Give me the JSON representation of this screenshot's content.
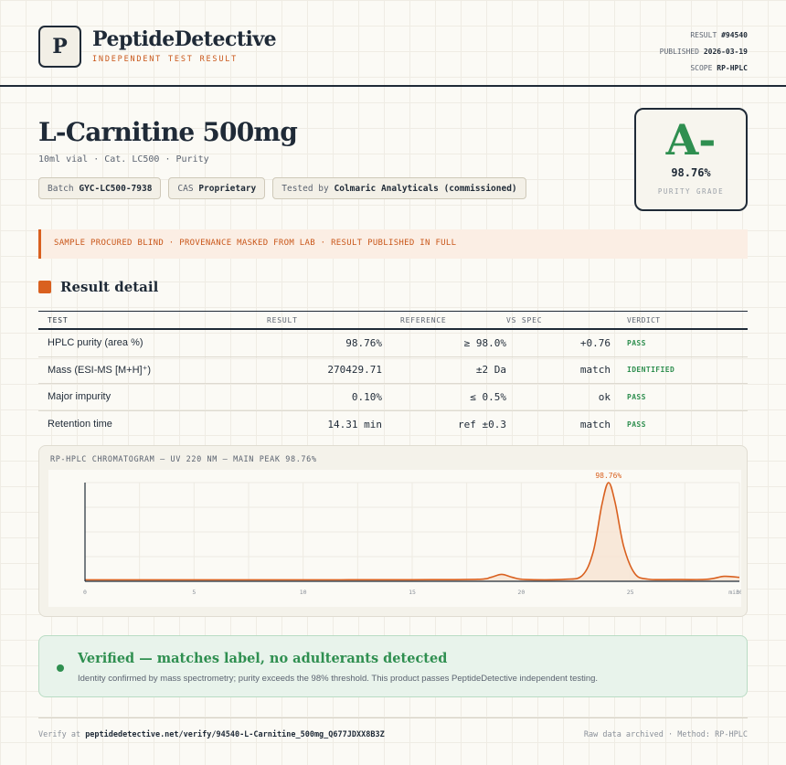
{
  "header": {
    "logo_letter": "P",
    "brand": "PeptideDetective",
    "brand_sub": "INDEPENDENT TEST RESULT",
    "meta": [
      {
        "label": "RESULT",
        "value": "#94540"
      },
      {
        "label": "PUBLISHED",
        "value": "2026-03-19"
      },
      {
        "label": "SCOPE",
        "value": "RP-HPLC"
      }
    ]
  },
  "product": {
    "title": "L-Carnitine 500mg",
    "subtitle": "10ml vial · Cat. LC500 · Purity",
    "chips": [
      {
        "label": "Batch",
        "value": "GYC-LC500-7938"
      },
      {
        "label": "CAS",
        "value": "Proprietary"
      },
      {
        "label": "Tested by",
        "value": "Colmaric Analyticals (commissioned)"
      }
    ]
  },
  "grade": {
    "letter": "A-",
    "percent": "98.76%",
    "label": "PURITY GRADE"
  },
  "notice": "SAMPLE PROCURED BLIND · PROVENANCE MASKED FROM LAB · RESULT PUBLISHED IN FULL",
  "section_title": "Result detail",
  "table": {
    "headers": [
      "TEST",
      "RESULT",
      "REFERENCE",
      "VS SPEC",
      "VERDICT"
    ],
    "rows": [
      {
        "test": "HPLC purity (area %)",
        "result": "98.76%",
        "reference": "≥ 98.0%",
        "vs_spec": "+0.76",
        "verdict": "PASS"
      },
      {
        "test": "Mass (ESI-MS [M+H]⁺)",
        "result": "270429.71",
        "reference": "±2 Da",
        "vs_spec": "match",
        "verdict": "IDENTIFIED"
      },
      {
        "test": "Major impurity",
        "result": "0.10%",
        "reference": "≤ 0.5%",
        "vs_spec": "ok",
        "verdict": "PASS"
      },
      {
        "test": "Retention time",
        "result": "14.31 min",
        "reference": "ref ±0.3",
        "vs_spec": "match",
        "verdict": "PASS"
      }
    ]
  },
  "chart_title": "RP-HPLC CHROMATOGRAM — UV 220 NM — MAIN PEAK 98.76%",
  "chart_data": {
    "type": "line",
    "title": "RP-HPLC CHROMATOGRAM — UV 220 NM — MAIN PEAK 98.76%",
    "xlabel": "",
    "ylabel": "",
    "xlim": [
      0,
      30
    ],
    "ylim": [
      0,
      100
    ],
    "x_ticks": [
      "0",
      "5",
      "10",
      "15",
      "20",
      "25",
      "30"
    ],
    "x_tick_suffix": "min",
    "peak_annotation": "98.76%",
    "x": [
      0,
      5,
      10,
      15,
      18,
      18.6,
      19.1,
      19.6,
      20.2,
      22,
      22.8,
      23.3,
      23.7,
      24.0,
      24.3,
      24.7,
      25.2,
      25.8,
      27,
      28.5,
      29.3,
      30
    ],
    "y": [
      1.5,
      1.5,
      1.5,
      1.6,
      2,
      4,
      7,
      4,
      1.8,
      2,
      6,
      30,
      78,
      100,
      80,
      35,
      8,
      2.2,
      1.8,
      2,
      5,
      4
    ],
    "line_color": "#d9601f",
    "fill_color": "#f8e3d2"
  },
  "verified": {
    "title": "Verified — matches label, no adulterants detected",
    "body": "Identity confirmed by mass spectrometry; purity exceeds the 98% threshold. This product passes PeptideDetective independent testing."
  },
  "footer": {
    "verify_prefix": "Verify at",
    "verify_url": "peptidedetective.net/verify/94540-L-Carnitine_500mg_Q677JDXX8B3Z",
    "right": "Raw data archived · Method: RP-HPLC"
  },
  "colors": {
    "accent": "#d9601f",
    "pass": "#2f8f50",
    "ink": "#1f2a37"
  }
}
